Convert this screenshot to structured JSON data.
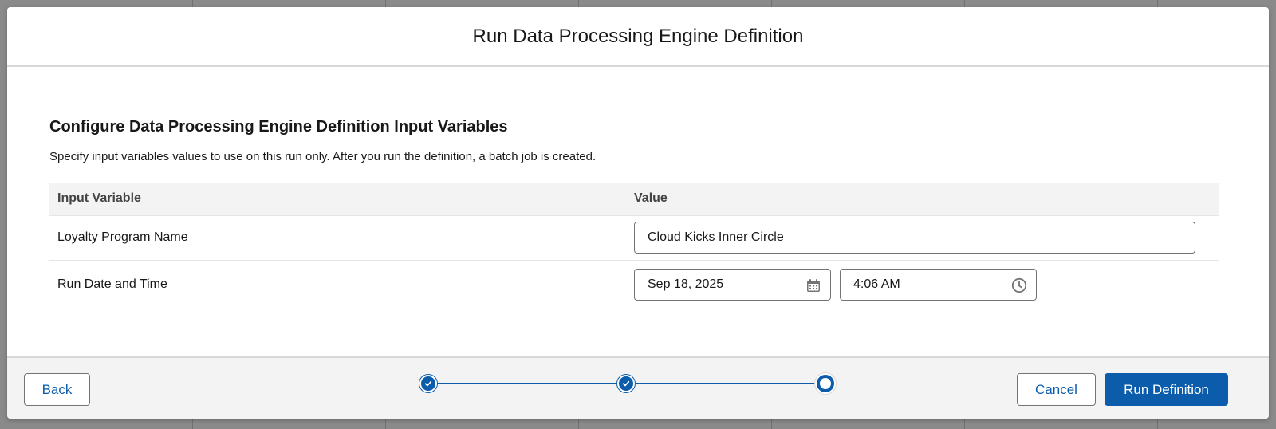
{
  "modal": {
    "title": "Run Data Processing Engine Definition"
  },
  "section": {
    "title": "Configure Data Processing Engine Definition Input Variables",
    "description": "Specify input variables values to use on this run only. After you run the definition, a batch job is created."
  },
  "table": {
    "headers": [
      "Input Variable",
      "Value"
    ],
    "rows": [
      {
        "label": "Loyalty Program Name",
        "value": "Cloud Kicks Inner Circle"
      },
      {
        "label": "Run Date and Time",
        "date": "Sep 18, 2025",
        "time": "4:06 AM"
      }
    ]
  },
  "footer": {
    "back_label": "Back",
    "cancel_label": "Cancel",
    "run_label": "Run Definition"
  },
  "progress": {
    "total_steps": 3,
    "completed_steps": 2,
    "current_step": 3
  },
  "colors": {
    "brand": "#0b5cab",
    "footer_bg": "#f3f3f3",
    "header_row_bg": "#f3f3f3"
  }
}
